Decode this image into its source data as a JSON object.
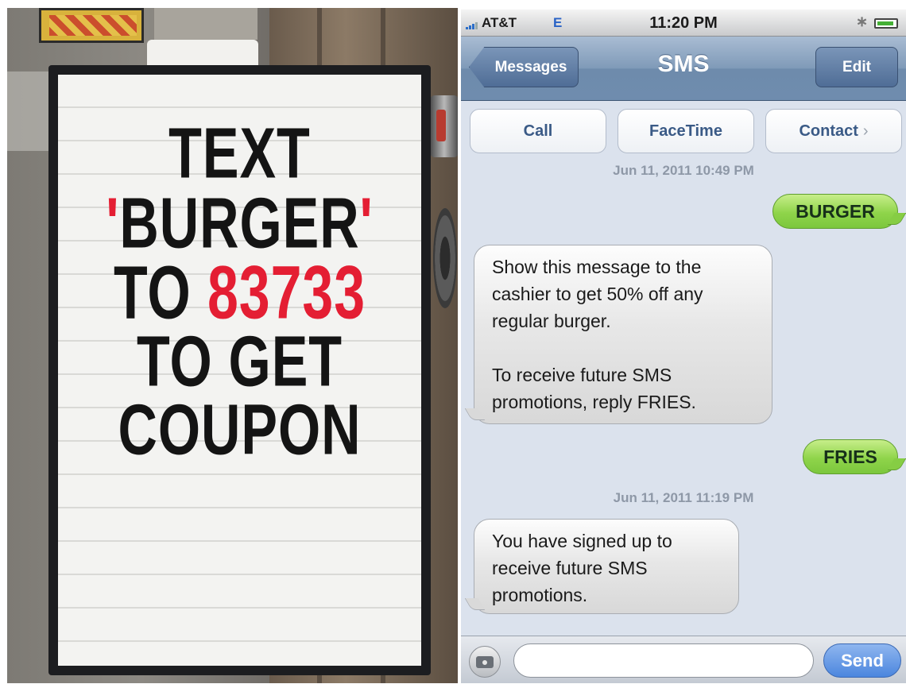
{
  "sign": {
    "lines": [
      {
        "text": "TEXT"
      },
      {
        "quote_open": "'",
        "word": "BURGER",
        "quote_close": "'"
      },
      {
        "prefix": "TO ",
        "number": "83733"
      },
      {
        "text": "TO GET"
      },
      {
        "text": "COUPON"
      }
    ]
  },
  "status_bar": {
    "carrier": "AT&T",
    "network": "E",
    "time": "11:20 PM"
  },
  "nav": {
    "back_label": "Messages",
    "title": "SMS",
    "edit_label": "Edit"
  },
  "actions": {
    "call": "Call",
    "facetime": "FaceTime",
    "contact": "Contact",
    "contact_chevron": "›"
  },
  "messages": [
    {
      "type": "timestamp",
      "text": "Jun 11, 2011 10:49 PM"
    },
    {
      "type": "sent",
      "text": "BURGER"
    },
    {
      "type": "received",
      "lines": [
        "Show this message to the",
        "cashier to get 50% off any",
        "regular burger.",
        "",
        "To receive future SMS",
        "promotions, reply FRIES."
      ]
    },
    {
      "type": "sent",
      "text": "FRIES"
    },
    {
      "type": "timestamp",
      "text": "Jun 11, 2011 11:19 PM"
    },
    {
      "type": "received",
      "lines": [
        "You have signed up to",
        "receive future SMS",
        "promotions."
      ]
    }
  ],
  "composer": {
    "value": "",
    "send_label": "Send"
  },
  "colors": {
    "sign_red": "#e41e33",
    "sent_bubble": "#8fd44a",
    "nav_bar": "#6f8cae",
    "send_button": "#4b86de"
  }
}
